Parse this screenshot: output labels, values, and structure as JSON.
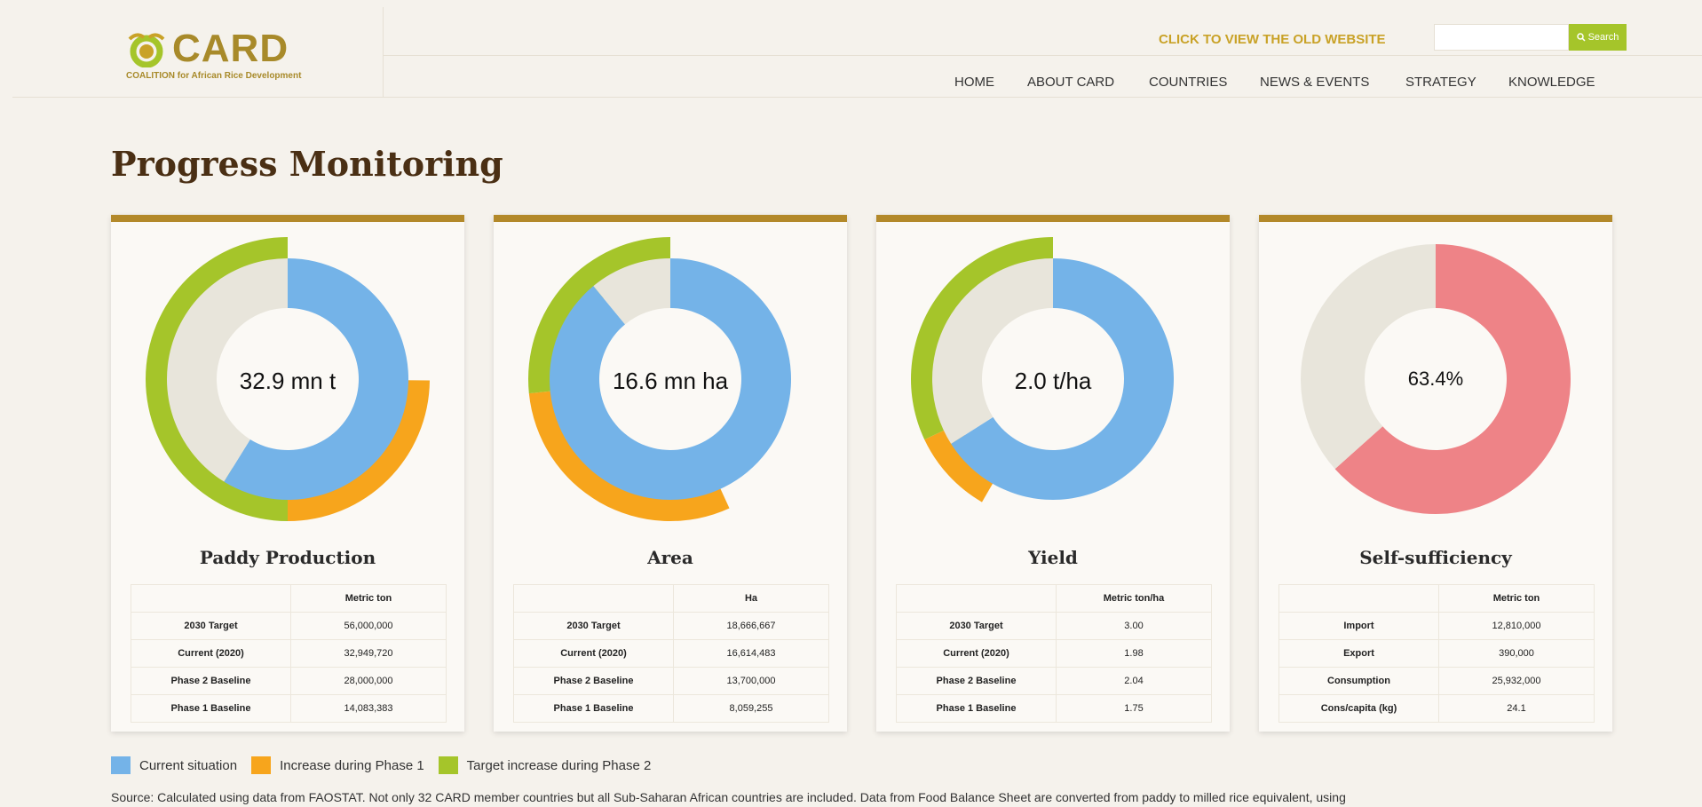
{
  "header": {
    "logo_word": "CARD",
    "logo_sub": "COALITION for African Rice Development",
    "old_site_link": "CLICK TO VIEW THE OLD WEBSITE",
    "search_placeholder": "",
    "search_label": "Search",
    "nav": [
      "HOME",
      "ABOUT CARD",
      "COUNTRIES",
      "NEWS & EVENTS",
      "STRATEGY",
      "KNOWLEDGE"
    ]
  },
  "page_title": "Progress Monitoring",
  "colors": {
    "current": "#74b3e8",
    "phase1": "#f7a51c",
    "phase2": "#a5c52a",
    "remainder": "#e8e5db",
    "selfsuff": "#ee8387",
    "card_top": "#b3892a"
  },
  "cards": [
    {
      "title": "Paddy Production",
      "center": "32.9 mn t",
      "unit": "Metric ton",
      "rows": [
        {
          "label": "2030 Target",
          "value": "56,000,000"
        },
        {
          "label": "Current (2020)",
          "value": "32,949,720"
        },
        {
          "label": "Phase 2 Baseline",
          "value": "28,000,000"
        },
        {
          "label": "Phase 1 Baseline",
          "value": "14,083,383"
        }
      ]
    },
    {
      "title": "Area",
      "center": "16.6 mn ha",
      "unit": "Ha",
      "rows": [
        {
          "label": "2030 Target",
          "value": "18,666,667"
        },
        {
          "label": "Current (2020)",
          "value": "16,614,483"
        },
        {
          "label": "Phase 2 Baseline",
          "value": "13,700,000"
        },
        {
          "label": "Phase 1 Baseline",
          "value": "8,059,255"
        }
      ]
    },
    {
      "title": "Yield",
      "center": "2.0 t/ha",
      "unit": "Metric ton/ha",
      "rows": [
        {
          "label": "2030 Target",
          "value": "3.00"
        },
        {
          "label": "Current (2020)",
          "value": "1.98"
        },
        {
          "label": "Phase 2 Baseline",
          "value": "2.04"
        },
        {
          "label": "Phase 1 Baseline",
          "value": "1.75"
        }
      ]
    },
    {
      "title": "Self-sufficiency",
      "center": "63.4%",
      "unit": "Metric ton",
      "rows": [
        {
          "label": "Import",
          "value": "12,810,000"
        },
        {
          "label": "Export",
          "value": "390,000"
        },
        {
          "label": "Consumption",
          "value": "25,932,000"
        },
        {
          "label": "Cons/capita (kg)",
          "value": "24.1"
        }
      ]
    }
  ],
  "legend": [
    "Current situation",
    "Increase during Phase 1",
    "Target increase during Phase 2"
  ],
  "source": "Source: Calculated using data from FAOSTAT. Not only 32 CARD member countries but all Sub-Saharan African countries are included. Data from Food Balance Sheet are converted from paddy to milled rice equivalent, using",
  "chart_data": [
    {
      "type": "pie",
      "title": "Paddy Production",
      "series": [
        {
          "values": [
            32949720,
            23050280
          ]
        },
        {
          "values": [
            14083383,
            13916617,
            28000000
          ]
        }
      ]
    },
    {
      "type": "pie",
      "title": "Area",
      "series": [
        {
          "values": [
            16614483,
            2052184
          ]
        },
        {
          "values": [
            8059255,
            5640745,
            4966667
          ]
        }
      ]
    },
    {
      "type": "pie",
      "title": "Yield",
      "series": [
        {
          "values": [
            1.98,
            1.02
          ]
        },
        {
          "values": [
            1.75,
            0.29,
            0.96
          ]
        }
      ]
    },
    {
      "type": "pie",
      "title": "Self-sufficiency",
      "series": [
        {
          "values": [
            63.4,
            36.6
          ]
        }
      ]
    }
  ]
}
